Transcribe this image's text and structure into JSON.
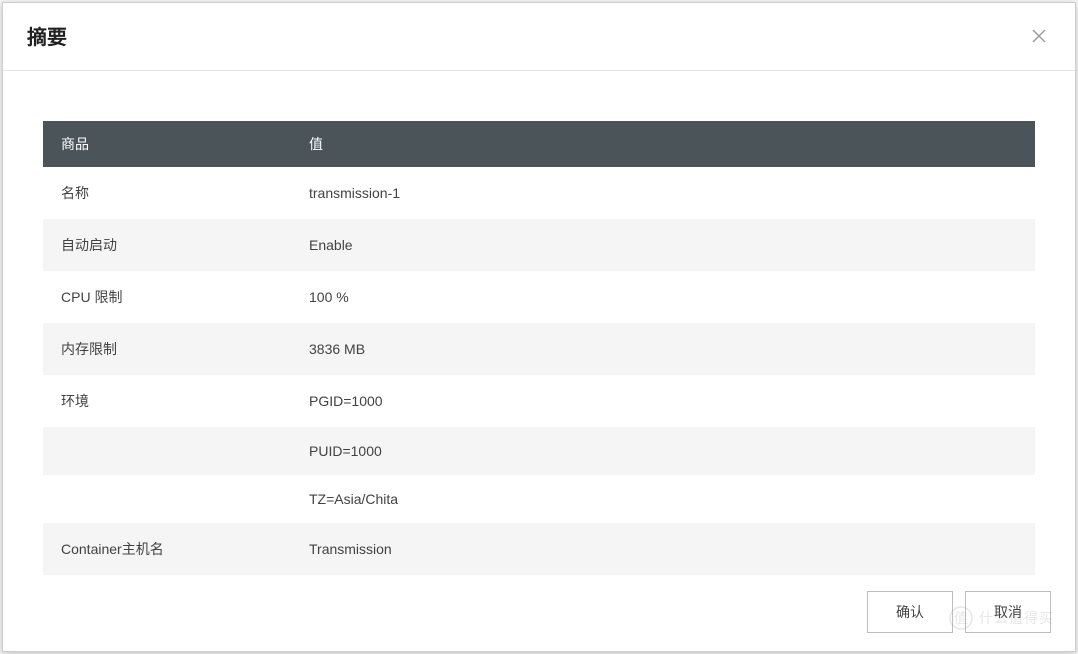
{
  "modal": {
    "title": "摘要",
    "table": {
      "headers": {
        "property": "商品",
        "value": "值"
      },
      "rows": [
        {
          "property": "名称",
          "value": "transmission-1"
        },
        {
          "property": "自动启动",
          "value": "Enable"
        },
        {
          "property": "CPU 限制",
          "value": "100 %"
        },
        {
          "property": "内存限制",
          "value": "3836 MB"
        },
        {
          "property": "环境",
          "value": "PGID=1000"
        },
        {
          "property": "",
          "value": "PUID=1000"
        },
        {
          "property": "",
          "value": "TZ=Asia/Chita"
        },
        {
          "property": "Container主机名",
          "value": "Transmission"
        }
      ]
    },
    "buttons": {
      "confirm": "确认",
      "cancel": "取消"
    }
  },
  "watermark": {
    "text": "什么值得买"
  }
}
